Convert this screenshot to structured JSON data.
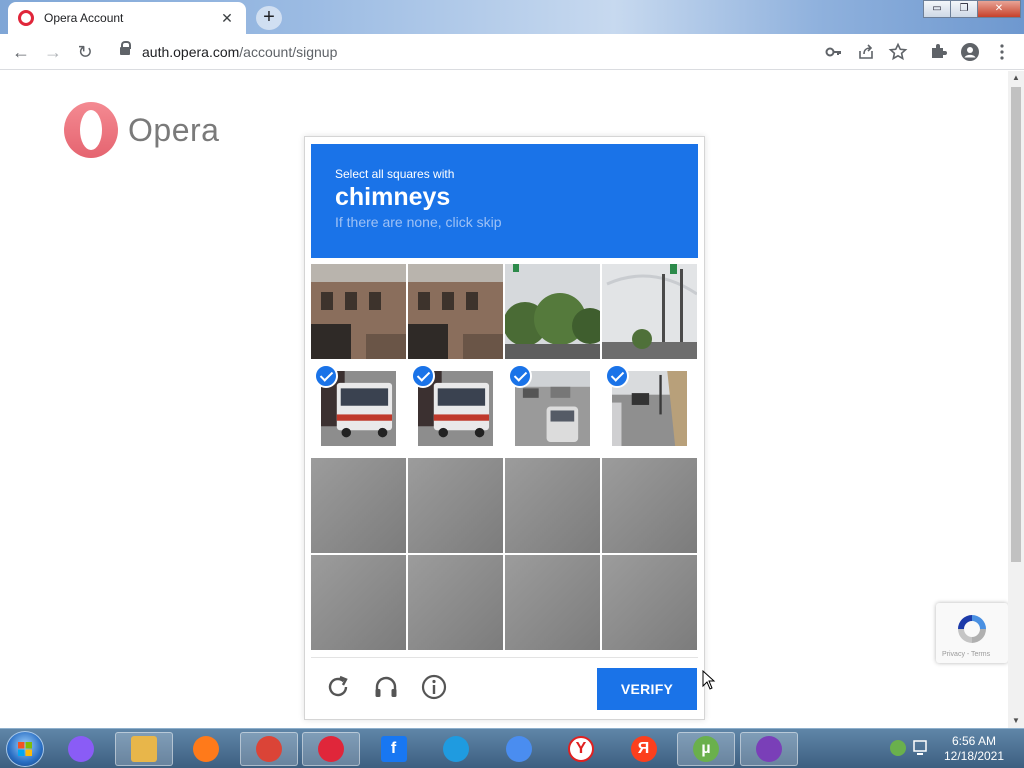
{
  "browser": {
    "tab_title": "Opera Account",
    "tab_close": "✕",
    "new_tab": "+",
    "url_domain": "auth.opera.com",
    "url_path": "/account/signup",
    "back": "←",
    "forward": "→",
    "reload": "↻",
    "window_controls": {
      "minimize": "▭",
      "restore": "❐",
      "close": "✕"
    }
  },
  "page": {
    "logo_word": "Opera",
    "recaptcha_links": "Privacy - Terms"
  },
  "captcha": {
    "instruction": "Select all squares with",
    "target": "chimneys",
    "hint": "If there are none, click skip",
    "verify_label": "VERIFY",
    "tiles": [
      {
        "scene": "building",
        "selected": false
      },
      {
        "scene": "building",
        "selected": false
      },
      {
        "scene": "trees",
        "selected": false
      },
      {
        "scene": "street-poles",
        "selected": false
      },
      {
        "scene": "bus",
        "selected": true
      },
      {
        "scene": "bus",
        "selected": true
      },
      {
        "scene": "cars",
        "selected": true
      },
      {
        "scene": "curb",
        "selected": true
      },
      {
        "scene": "road",
        "selected": false
      },
      {
        "scene": "road",
        "selected": false
      },
      {
        "scene": "road",
        "selected": false
      },
      {
        "scene": "road",
        "selected": false
      },
      {
        "scene": "road",
        "selected": false
      },
      {
        "scene": "road",
        "selected": false
      },
      {
        "scene": "road",
        "selected": false
      },
      {
        "scene": "road",
        "selected": false
      }
    ]
  },
  "taskbar": {
    "clock_time": "6:56 AM",
    "clock_date": "12/18/2021",
    "apps": [
      {
        "name": "alice",
        "glyph": "",
        "color": "#8a5cf6",
        "active": false
      },
      {
        "name": "file-explorer",
        "glyph": "",
        "color": "#e8b64a",
        "active": true
      },
      {
        "name": "firefox",
        "glyph": "",
        "color": "#ff7a1a",
        "active": false
      },
      {
        "name": "chrome",
        "glyph": "",
        "color": "#db4437",
        "active": true
      },
      {
        "name": "opera",
        "glyph": "",
        "color": "#e0263a",
        "active": true
      },
      {
        "name": "facebook",
        "glyph": "f",
        "color": "#1877f2",
        "active": false
      },
      {
        "name": "edge",
        "glyph": "",
        "color": "#1f9be0",
        "active": false
      },
      {
        "name": "chromium",
        "glyph": "",
        "color": "#4a8df0",
        "active": false
      },
      {
        "name": "yandex-browser",
        "glyph": "Y",
        "color": "#ffffff",
        "active": false
      },
      {
        "name": "yandex",
        "glyph": "Я",
        "color": "#fc3f1d",
        "active": false
      },
      {
        "name": "utorrent",
        "glyph": "µ",
        "color": "#6ab04c",
        "active": true
      },
      {
        "name": "bonzi",
        "glyph": "",
        "color": "#7a3fb8",
        "active": true
      }
    ]
  }
}
